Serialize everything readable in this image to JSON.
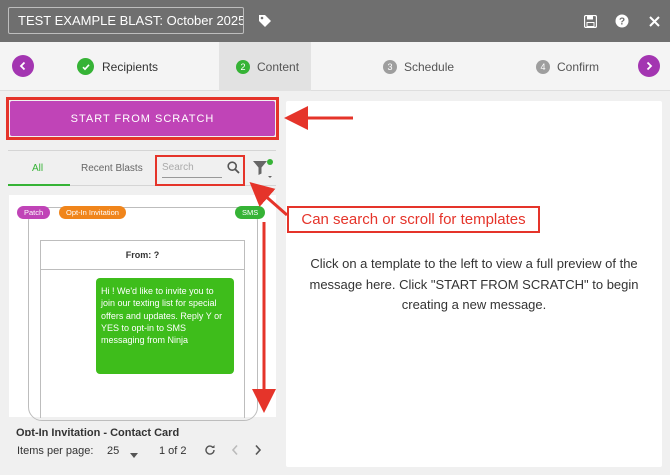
{
  "header": {
    "blast_title": "TEST EXAMPLE BLAST: October 2025"
  },
  "stepper": {
    "steps": [
      {
        "number": "",
        "label": "Recipients",
        "state": "done"
      },
      {
        "number": "2",
        "label": "Content",
        "state": "active"
      },
      {
        "number": "3",
        "label": "Schedule",
        "state": "pending"
      },
      {
        "number": "4",
        "label": "Confirm",
        "state": "pending"
      }
    ]
  },
  "left_panel": {
    "start_button_label": "START FROM SCRATCH",
    "tabs": [
      "All",
      "Recent Blasts"
    ],
    "search_placeholder": "Search",
    "template_card": {
      "badges": [
        "Patch",
        "Opt-In Invitation",
        "SMS"
      ],
      "from_label": "From: ?",
      "message": "Hi ! We'd like to invite you to join our texting list for special offers and updates. Reply Y or YES to opt-in to SMS messaging from Ninja",
      "title": "Opt-In Invitation - Contact Card"
    },
    "pagination": {
      "items_per_page_label": "Items per page:",
      "items_per_page_value": "25",
      "page_text": "1 of 2"
    }
  },
  "preview": {
    "text": "Click on a template to the left to view a full preview of the message here. Click \"START FROM SCRATCH\" to begin creating a new message."
  },
  "annotation": {
    "callout": "Can search or scroll for templates"
  },
  "colors": {
    "topbar": "#6f6f6f",
    "accent_purple": "#a335b1",
    "scratch_button": "#c044b7",
    "success_green": "#36b336",
    "sms_bubble": "#3ebd1b",
    "badge_patch": "#c044b7",
    "badge_optin": "#f0851b",
    "badge_sms": "#36b336",
    "annotation_red": "#e5342a"
  },
  "icons": [
    "tag-icon",
    "save-icon",
    "help-icon",
    "close-icon",
    "chevron-left-icon",
    "chevron-right-icon",
    "check-icon",
    "search-icon",
    "filter-icon",
    "refresh-icon"
  ]
}
